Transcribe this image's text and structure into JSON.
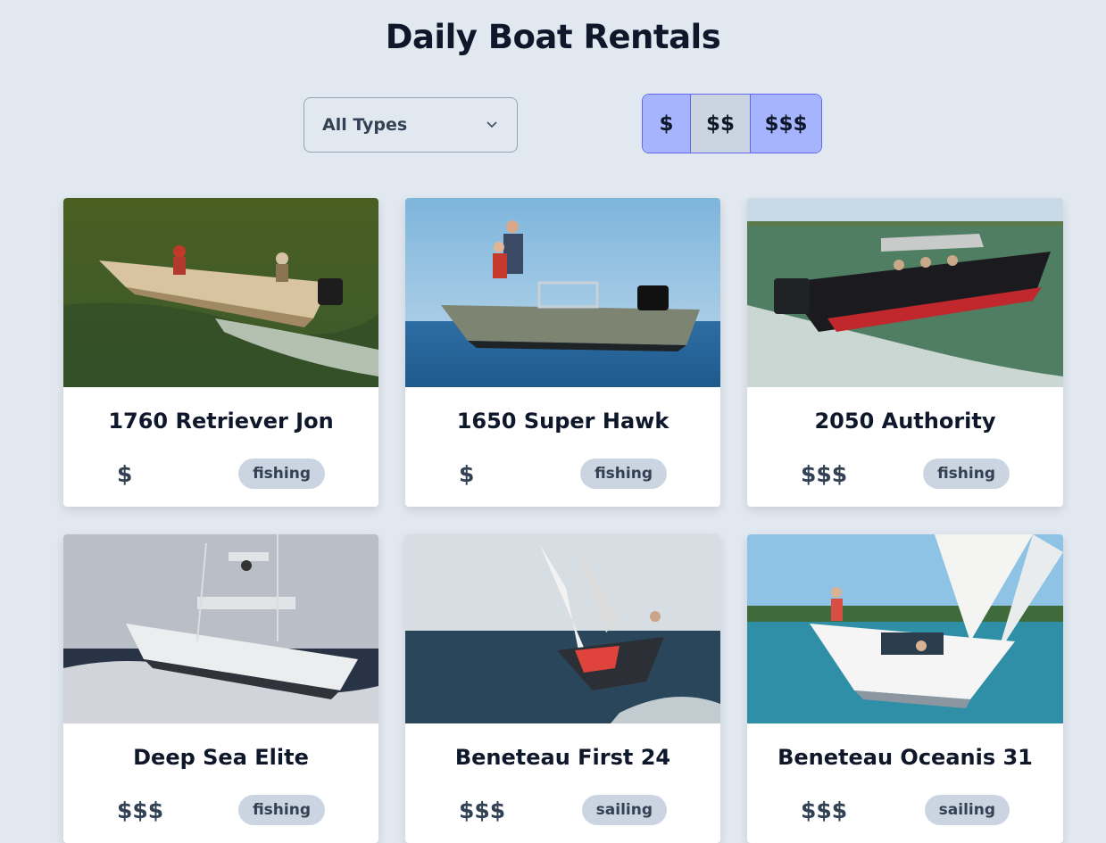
{
  "header": {
    "title": "Daily Boat Rentals"
  },
  "filters": {
    "type_select": {
      "value": "All Types"
    },
    "price_buttons": [
      {
        "label": "$",
        "active": true
      },
      {
        "label": "$$",
        "active": false
      },
      {
        "label": "$$$",
        "active": true
      }
    ]
  },
  "boats": [
    {
      "name": "1760 Retriever Jon",
      "price": "$",
      "type": "fishing"
    },
    {
      "name": "1650 Super Hawk",
      "price": "$",
      "type": "fishing"
    },
    {
      "name": "2050 Authority",
      "price": "$$$",
      "type": "fishing"
    },
    {
      "name": "Deep Sea Elite",
      "price": "$$$",
      "type": "fishing"
    },
    {
      "name": "Beneteau First 24",
      "price": "$$$",
      "type": "sailing"
    },
    {
      "name": "Beneteau Oceanis 31",
      "price": "$$$",
      "type": "sailing"
    }
  ],
  "colors": {
    "background": "#e2e8f0",
    "accent": "#a5b4fc",
    "accent_border": "#6366f1",
    "tag_bg": "#cbd5e1"
  }
}
